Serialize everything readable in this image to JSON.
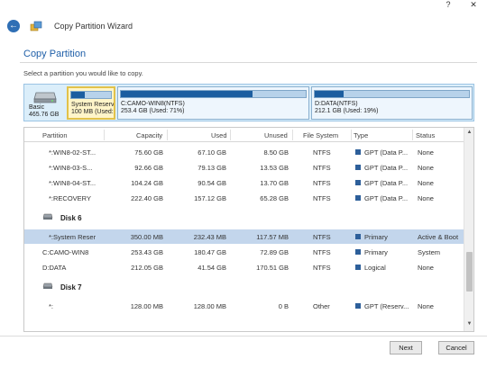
{
  "window": {
    "title": "Copy Partition Wizard",
    "help_label": "?",
    "close_label": "✕"
  },
  "header": {
    "heading": "Copy Partition",
    "instruction": "Select a partition you would like to copy."
  },
  "disk_map": {
    "disk_label_line1": "Basic",
    "disk_label_line2": "465.76 GB",
    "partitions": [
      {
        "name": "System Reserv",
        "detail": "100 MB (Used:",
        "used_fraction": 0.33,
        "selected": true
      },
      {
        "name": "C:CAMO-WIN8(NTFS)",
        "detail": "253.4 GB (Used: 71%)",
        "used_fraction": 0.71,
        "selected": false
      },
      {
        "name": "D:DATA(NTFS)",
        "detail": "212.1 GB (Used: 19%)",
        "used_fraction": 0.19,
        "selected": false
      }
    ]
  },
  "table": {
    "columns": [
      "Partition",
      "Capacity",
      "Used",
      "Unused",
      "File System",
      "Type",
      "Status"
    ],
    "rows_top": [
      {
        "partition": "*:WIN8-02-ST...",
        "capacity": "75.60 GB",
        "used": "67.10 GB",
        "unused": "8.50 GB",
        "fs": "NTFS",
        "type": "GPT (Data P...",
        "status": "None"
      },
      {
        "partition": "*:WIN8-03-S...",
        "capacity": "92.66 GB",
        "used": "79.13 GB",
        "unused": "13.53 GB",
        "fs": "NTFS",
        "type": "GPT (Data P...",
        "status": "None"
      },
      {
        "partition": "*:WIN8-04-ST...",
        "capacity": "104.24 GB",
        "used": "90.54 GB",
        "unused": "13.70 GB",
        "fs": "NTFS",
        "type": "GPT (Data P...",
        "status": "None"
      },
      {
        "partition": "*:RECOVERY",
        "capacity": "222.40 GB",
        "used": "157.12 GB",
        "unused": "65.28 GB",
        "fs": "NTFS",
        "type": "GPT (Data P...",
        "status": "None"
      }
    ],
    "disk6_label": "Disk 6",
    "rows_disk6": [
      {
        "partition": "*:System Reser",
        "capacity": "350.00 MB",
        "used": "232.43 MB",
        "unused": "117.57 MB",
        "fs": "NTFS",
        "type": "Primary",
        "status": "Active & Boot"
      },
      {
        "partition": "C:CAMO-WIN8",
        "capacity": "253.43 GB",
        "used": "180.47 GB",
        "unused": "72.89 GB",
        "fs": "NTFS",
        "type": "Primary",
        "status": "System"
      },
      {
        "partition": "D:DATA",
        "capacity": "212.05 GB",
        "used": "41.54 GB",
        "unused": "170.51 GB",
        "fs": "NTFS",
        "type": "Logical",
        "status": "None"
      }
    ],
    "disk7_label": "Disk 7",
    "rows_disk7": [
      {
        "partition": "*:",
        "capacity": "128.00 MB",
        "used": "128.00 MB",
        "unused": "0 B",
        "fs": "Other",
        "type": "GPT (Reserv...",
        "status": "None"
      }
    ]
  },
  "footer": {
    "next_label": "Next",
    "cancel_label": "Cancel"
  },
  "colors": {
    "accent": "#1f5fa8",
    "selection": "#c3d6ec",
    "partition_fill": "#1c5ea0"
  }
}
